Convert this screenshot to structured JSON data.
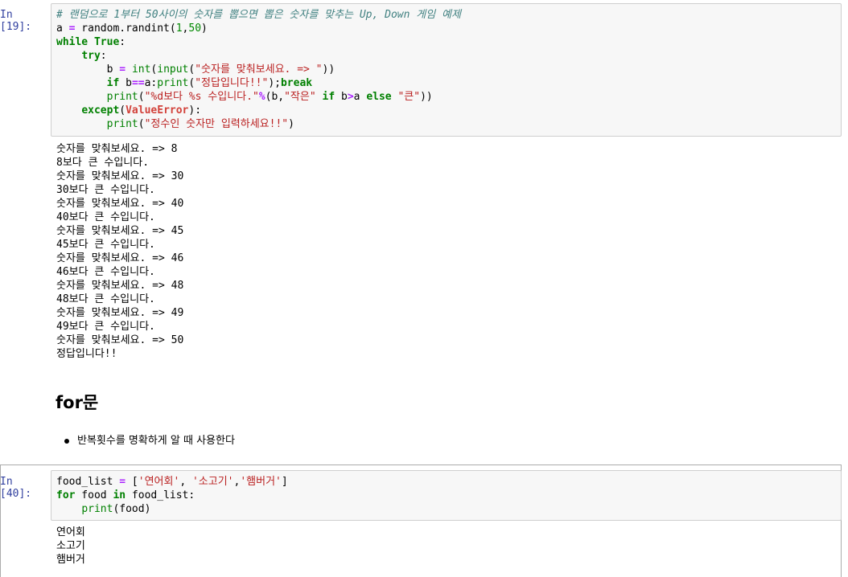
{
  "cell1": {
    "prompt": "In [19]:",
    "code_lines": [
      [
        {
          "t": "# 랜덤으로 1부터 50사이의 숫자를 뽑으면 뽑은 숫자를 맞추는 Up, Down 게임 예제",
          "c": "comment"
        }
      ],
      [
        {
          "t": "a ",
          "c": ""
        },
        {
          "t": "=",
          "c": "op"
        },
        {
          "t": " random.randint(",
          "c": ""
        },
        {
          "t": "1",
          "c": "num"
        },
        {
          "t": ",",
          "c": ""
        },
        {
          "t": "50",
          "c": "num"
        },
        {
          "t": ")",
          "c": ""
        }
      ],
      [
        {
          "t": "while",
          "c": "kw"
        },
        {
          "t": " ",
          "c": ""
        },
        {
          "t": "True",
          "c": "kw"
        },
        {
          "t": ":",
          "c": ""
        }
      ],
      [
        {
          "t": "    ",
          "c": ""
        },
        {
          "t": "try",
          "c": "kw"
        },
        {
          "t": ":",
          "c": ""
        }
      ],
      [
        {
          "t": "        b ",
          "c": ""
        },
        {
          "t": "=",
          "c": "op"
        },
        {
          "t": " ",
          "c": ""
        },
        {
          "t": "int",
          "c": "bi"
        },
        {
          "t": "(",
          "c": ""
        },
        {
          "t": "input",
          "c": "bi"
        },
        {
          "t": "(",
          "c": ""
        },
        {
          "t": "\"숫자를 맞춰보세요. => \"",
          "c": "str"
        },
        {
          "t": "))",
          "c": ""
        }
      ],
      [
        {
          "t": "        ",
          "c": ""
        },
        {
          "t": "if",
          "c": "kw"
        },
        {
          "t": " b",
          "c": ""
        },
        {
          "t": "==",
          "c": "op"
        },
        {
          "t": "a:",
          "c": ""
        },
        {
          "t": "print",
          "c": "bi"
        },
        {
          "t": "(",
          "c": ""
        },
        {
          "t": "\"정답입니다!!\"",
          "c": "str"
        },
        {
          "t": ");",
          "c": ""
        },
        {
          "t": "break",
          "c": "kw"
        }
      ],
      [
        {
          "t": "        ",
          "c": ""
        },
        {
          "t": "print",
          "c": "bi"
        },
        {
          "t": "(",
          "c": ""
        },
        {
          "t": "\"%d보다 %s 수입니다.\"",
          "c": "str"
        },
        {
          "t": "%",
          "c": "op"
        },
        {
          "t": "(b,",
          "c": ""
        },
        {
          "t": "\"작은\"",
          "c": "str"
        },
        {
          "t": " ",
          "c": ""
        },
        {
          "t": "if",
          "c": "kw"
        },
        {
          "t": " b",
          "c": ""
        },
        {
          "t": ">",
          "c": "op"
        },
        {
          "t": "a ",
          "c": ""
        },
        {
          "t": "else",
          "c": "kw"
        },
        {
          "t": " ",
          "c": ""
        },
        {
          "t": "\"큰\"",
          "c": "str"
        },
        {
          "t": "))",
          "c": ""
        }
      ],
      [
        {
          "t": "    ",
          "c": ""
        },
        {
          "t": "except",
          "c": "kw"
        },
        {
          "t": "(",
          "c": ""
        },
        {
          "t": "ValueError",
          "c": "exc"
        },
        {
          "t": "):",
          "c": ""
        }
      ],
      [
        {
          "t": "        ",
          "c": ""
        },
        {
          "t": "print",
          "c": "bi"
        },
        {
          "t": "(",
          "c": ""
        },
        {
          "t": "\"정수인 숫자만 입력하세요!!\"",
          "c": "str"
        },
        {
          "t": ")",
          "c": ""
        }
      ]
    ],
    "output_lines": [
      "숫자를 맞춰보세요. => 8",
      "8보다 큰 수입니다.",
      "숫자를 맞춰보세요. => 30",
      "30보다 큰 수입니다.",
      "숫자를 맞춰보세요. => 40",
      "40보다 큰 수입니다.",
      "숫자를 맞춰보세요. => 45",
      "45보다 큰 수입니다.",
      "숫자를 맞춰보세요. => 46",
      "46보다 큰 수입니다.",
      "숫자를 맞춰보세요. => 48",
      "48보다 큰 수입니다.",
      "숫자를 맞춰보세요. => 49",
      "49보다 큰 수입니다.",
      "숫자를 맞춰보세요. => 50",
      "정답입니다!!"
    ]
  },
  "markdown": {
    "heading": "for문",
    "bullet": "반복횟수를 명확하게 알 때 사용한다"
  },
  "cell2": {
    "prompt": "In [40]:",
    "code_lines": [
      [
        {
          "t": "food_list ",
          "c": ""
        },
        {
          "t": "=",
          "c": "op"
        },
        {
          "t": " [",
          "c": ""
        },
        {
          "t": "'연어회'",
          "c": "str"
        },
        {
          "t": ", ",
          "c": ""
        },
        {
          "t": "'소고기'",
          "c": "str"
        },
        {
          "t": ",",
          "c": ""
        },
        {
          "t": "'햄버거'",
          "c": "str"
        },
        {
          "t": "]",
          "c": ""
        }
      ],
      [
        {
          "t": "for",
          "c": "kw"
        },
        {
          "t": " food ",
          "c": ""
        },
        {
          "t": "in",
          "c": "kw"
        },
        {
          "t": " food_list:",
          "c": ""
        }
      ],
      [
        {
          "t": "    ",
          "c": ""
        },
        {
          "t": "print",
          "c": "bi"
        },
        {
          "t": "(food)",
          "c": ""
        }
      ]
    ],
    "output_lines": [
      "연어회",
      "소고기",
      "햄버거"
    ]
  }
}
